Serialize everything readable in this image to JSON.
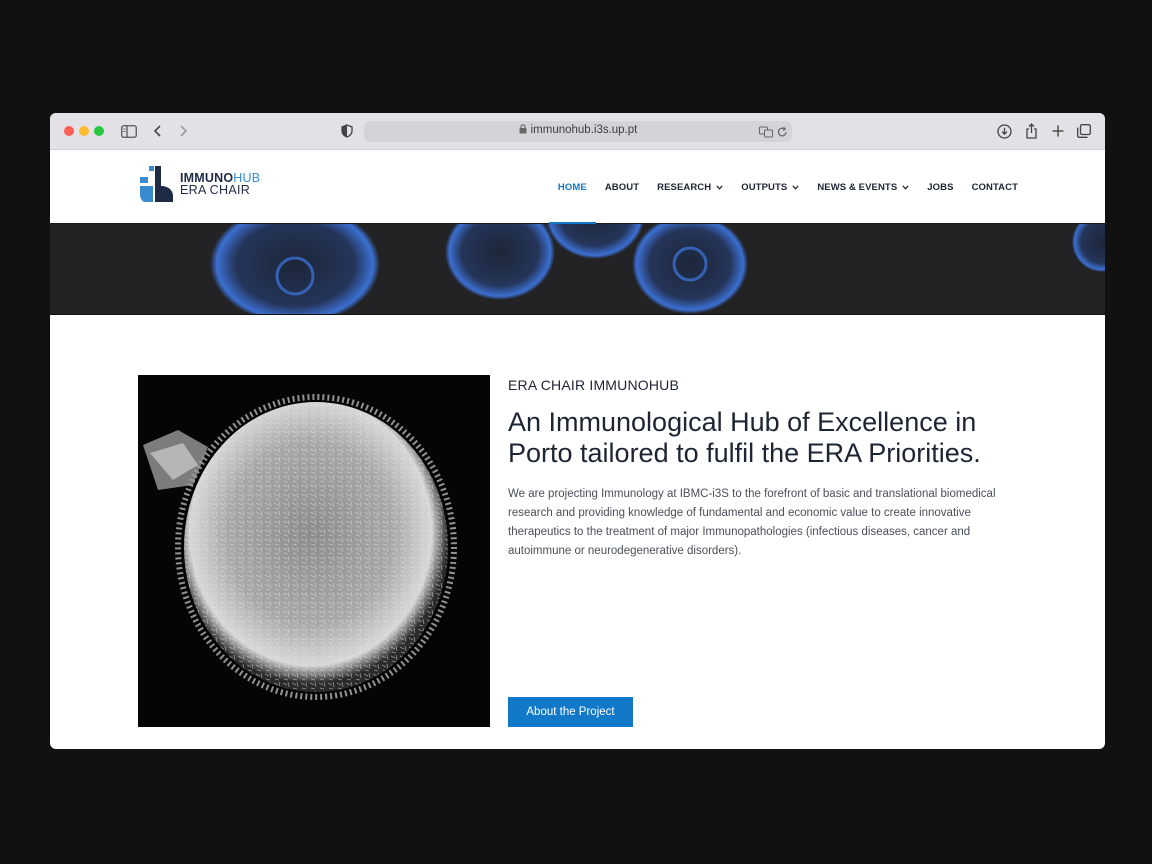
{
  "browser": {
    "url": "immunohub.i3s.up.pt"
  },
  "site": {
    "logo": {
      "line1_bold": "IMMUNO",
      "line1_light": "HUB",
      "line2": "ERA CHAIR"
    },
    "nav": [
      {
        "label": "HOME",
        "active": true,
        "has_dropdown": false
      },
      {
        "label": "ABOUT",
        "active": false,
        "has_dropdown": false
      },
      {
        "label": "RESEARCH",
        "active": false,
        "has_dropdown": true
      },
      {
        "label": "OUTPUTS",
        "active": false,
        "has_dropdown": true
      },
      {
        "label": "NEWS & EVENTS",
        "active": false,
        "has_dropdown": true
      },
      {
        "label": "JOBS",
        "active": false,
        "has_dropdown": false
      },
      {
        "label": "CONTACT",
        "active": false,
        "has_dropdown": false
      }
    ]
  },
  "main": {
    "eyebrow": "ERA CHAIR IMMUNOHUB",
    "headline": "An Immunological Hub of Excellence in Porto tailored to fulfil the ERA Priorities.",
    "body": "We are projecting Immunology at IBMC-i3S to the forefront of basic and translational biomedical research and providing knowledge of fundamental and economic value to create innovative therapeutics to the treatment of major Immunopathologies (infectious diseases, cancer and autoimmune or neurodegenerative disorders).",
    "cta_label": "About the Project"
  },
  "colors": {
    "accent": "#1279c9",
    "text_dark": "#1d2433",
    "banner_bg": "#232325",
    "banner_cells": "#3b6fd1"
  }
}
